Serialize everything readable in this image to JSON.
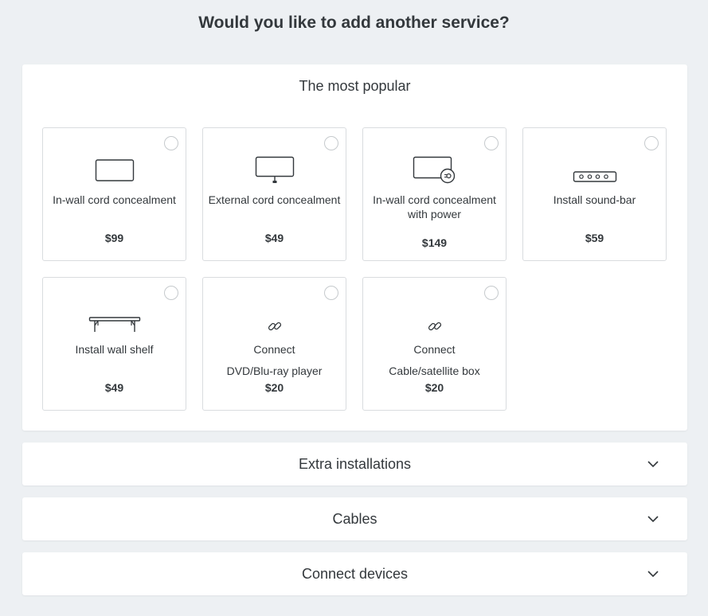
{
  "heading": "Would you like to add another service?",
  "popular": {
    "title": "The most popular",
    "cards": [
      {
        "label": "In-wall cord concealment",
        "label2": "",
        "price": "$99",
        "icon": "wall-panel-icon"
      },
      {
        "label": "External cord concealment",
        "label2": "",
        "price": "$49",
        "icon": "tv-stand-icon"
      },
      {
        "label": "In-wall cord concealment with power",
        "label2": "",
        "price": "$149",
        "icon": "wall-panel-power-icon"
      },
      {
        "label": "Install sound-bar",
        "label2": "",
        "price": "$59",
        "icon": "soundbar-icon"
      },
      {
        "label": "Install wall shelf",
        "label2": "",
        "price": "$49",
        "icon": "shelf-icon"
      },
      {
        "label": "Connect",
        "label2": "DVD/Blu-ray player",
        "price": "$20",
        "icon": "link-icon"
      },
      {
        "label": "Connect",
        "label2": "Cable/satellite box",
        "price": "$20",
        "icon": "link-icon"
      }
    ]
  },
  "sections": [
    {
      "title": "Extra installations"
    },
    {
      "title": "Cables"
    },
    {
      "title": "Connect devices"
    }
  ],
  "colors": {
    "background": "#edf0f3",
    "panel": "#ffffff",
    "border": "#d9dcdf",
    "text": "#33383c"
  }
}
